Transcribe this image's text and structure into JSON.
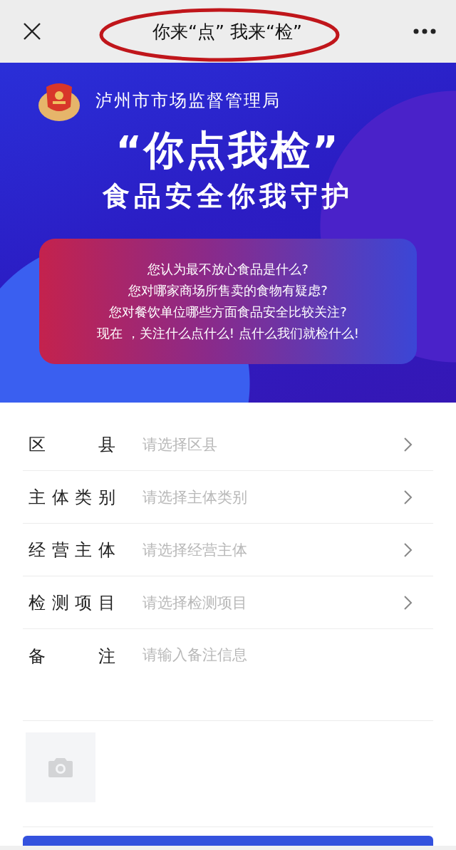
{
  "nav_bar": {
    "title": "你来“点” 我来“检”",
    "annotated": true
  },
  "banner": {
    "agency": "泸州市市场监督管理局",
    "headline": "“你点我检”",
    "slogan": "食品安全你我守护",
    "card_lines": [
      "您认为最不放心食品是什么?",
      "您对哪家商场所售卖的食物有疑虑?",
      "您对餐饮单位哪些方面食品安全比较关注?",
      "现在 ，关注什么点什么! 点什么我们就检什么!"
    ]
  },
  "form": {
    "fields": [
      {
        "kind": "select",
        "label": "区县",
        "placeholder": "请选择区县"
      },
      {
        "kind": "select",
        "label": "主体类别",
        "placeholder": "请选择主体类别"
      },
      {
        "kind": "select",
        "label": "经营主体",
        "placeholder": "请选择经营主体"
      },
      {
        "kind": "select",
        "label": "检测项目",
        "placeholder": "请选择检测项目"
      },
      {
        "kind": "textarea",
        "label": "备注",
        "placeholder": "请输入备注信息"
      }
    ],
    "photo_upload": {
      "kind": "camera"
    }
  }
}
